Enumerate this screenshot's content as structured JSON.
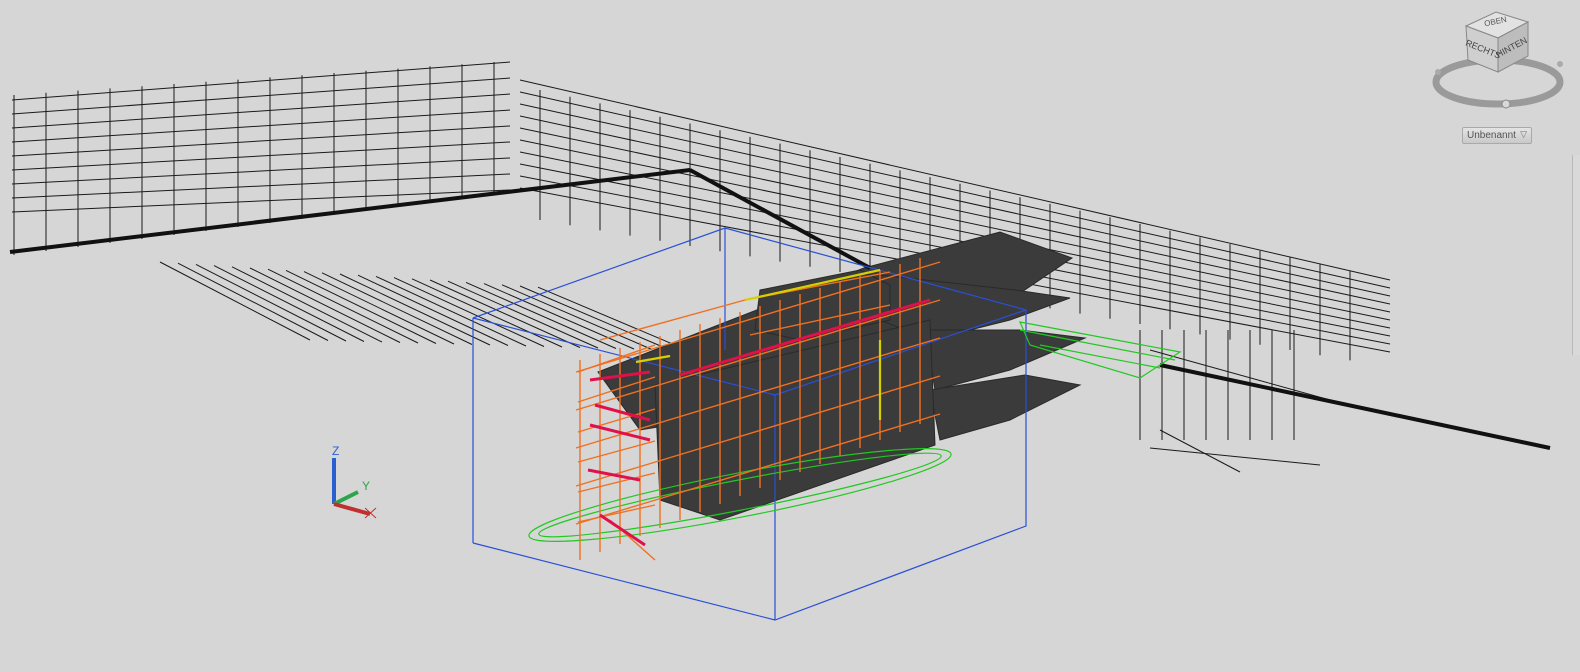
{
  "app": "3D Viewport",
  "viewcube": {
    "faces": {
      "top": "OBEN",
      "left": "RECHTS",
      "right": "HINTEN"
    }
  },
  "view_dropdown": {
    "label": "Unbenannt",
    "arrow_icon": "chevron-down-icon"
  },
  "ucs_icon": {
    "z_label": "Z",
    "y_label": "Y",
    "x_label": "X"
  },
  "colors": {
    "background": "#d6d6d6",
    "wireframe": "#1a1a1a",
    "scaffold": "#f07020",
    "stair_accent": "#e0104a",
    "walkway": "#22c822",
    "bounding_box": "#2a4fd6",
    "slab": "#3a3a3a",
    "beam": "#d7d000"
  }
}
